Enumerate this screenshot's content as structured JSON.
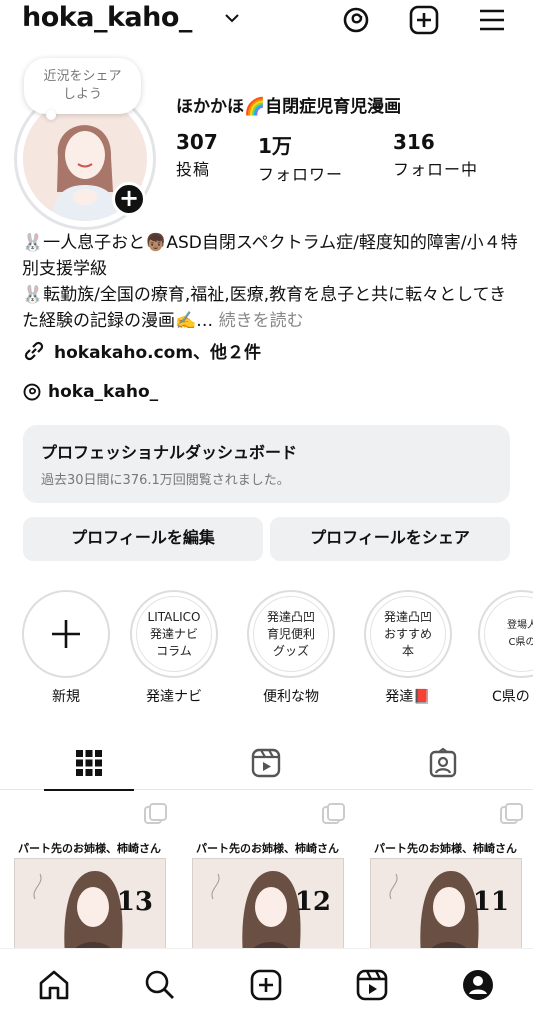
{
  "header": {
    "username": "hoka_kaho_"
  },
  "profile": {
    "note_bubble": "近況をシェア\nしよう",
    "display_name": "ほかかほ🌈自閉症児育児漫画",
    "stats": [
      {
        "value": "307",
        "label": "投稿"
      },
      {
        "value": "1万",
        "label": "フォロワー"
      },
      {
        "value": "316",
        "label": "フォロー中"
      }
    ],
    "bio_line1": "🐰一人息子おと👦🏽ASD自閉スペクトラム症/軽度知的障害/小４特別支援学級",
    "bio_line2": "🐰転勤族/全国の療育,福祉,医療,教育を息子と共に転々としてきた経験の記録の漫画✍️…",
    "bio_more": "続きを読む",
    "link_text": "hokakaho.com、他２件",
    "threads_handle": "hoka_kaho_"
  },
  "dashboard": {
    "title": "プロフェッショナルダッシュボード",
    "subtitle": "過去30日間に376.1万回閲覧されました。"
  },
  "buttons": {
    "edit": "プロフィールを編集",
    "share": "プロフィールをシェア"
  },
  "highlights": [
    {
      "inner": "+",
      "label": "新規"
    },
    {
      "inner": "LITALICO\n発達ナビ\nコラム",
      "label": "発達ナビ"
    },
    {
      "inner": "発達凸凹\n育児便利\nグッズ",
      "label": "便利な物"
    },
    {
      "inner": "発達凸凹\nおすすめ\n本",
      "label": "発達📕"
    },
    {
      "inner": "登場人\nC県の",
      "label": "C県の"
    }
  ],
  "posts": [
    {
      "title": "パート先のお姉様、柿崎さん",
      "number": "13"
    },
    {
      "title": "パート先のお姉様、柿崎さん",
      "number": "12"
    },
    {
      "title": "パート先のお姉様、柿崎さん",
      "number": "11"
    }
  ],
  "colors": {
    "surface": "#eff0f2",
    "text": "#111111",
    "muted": "#888888"
  }
}
